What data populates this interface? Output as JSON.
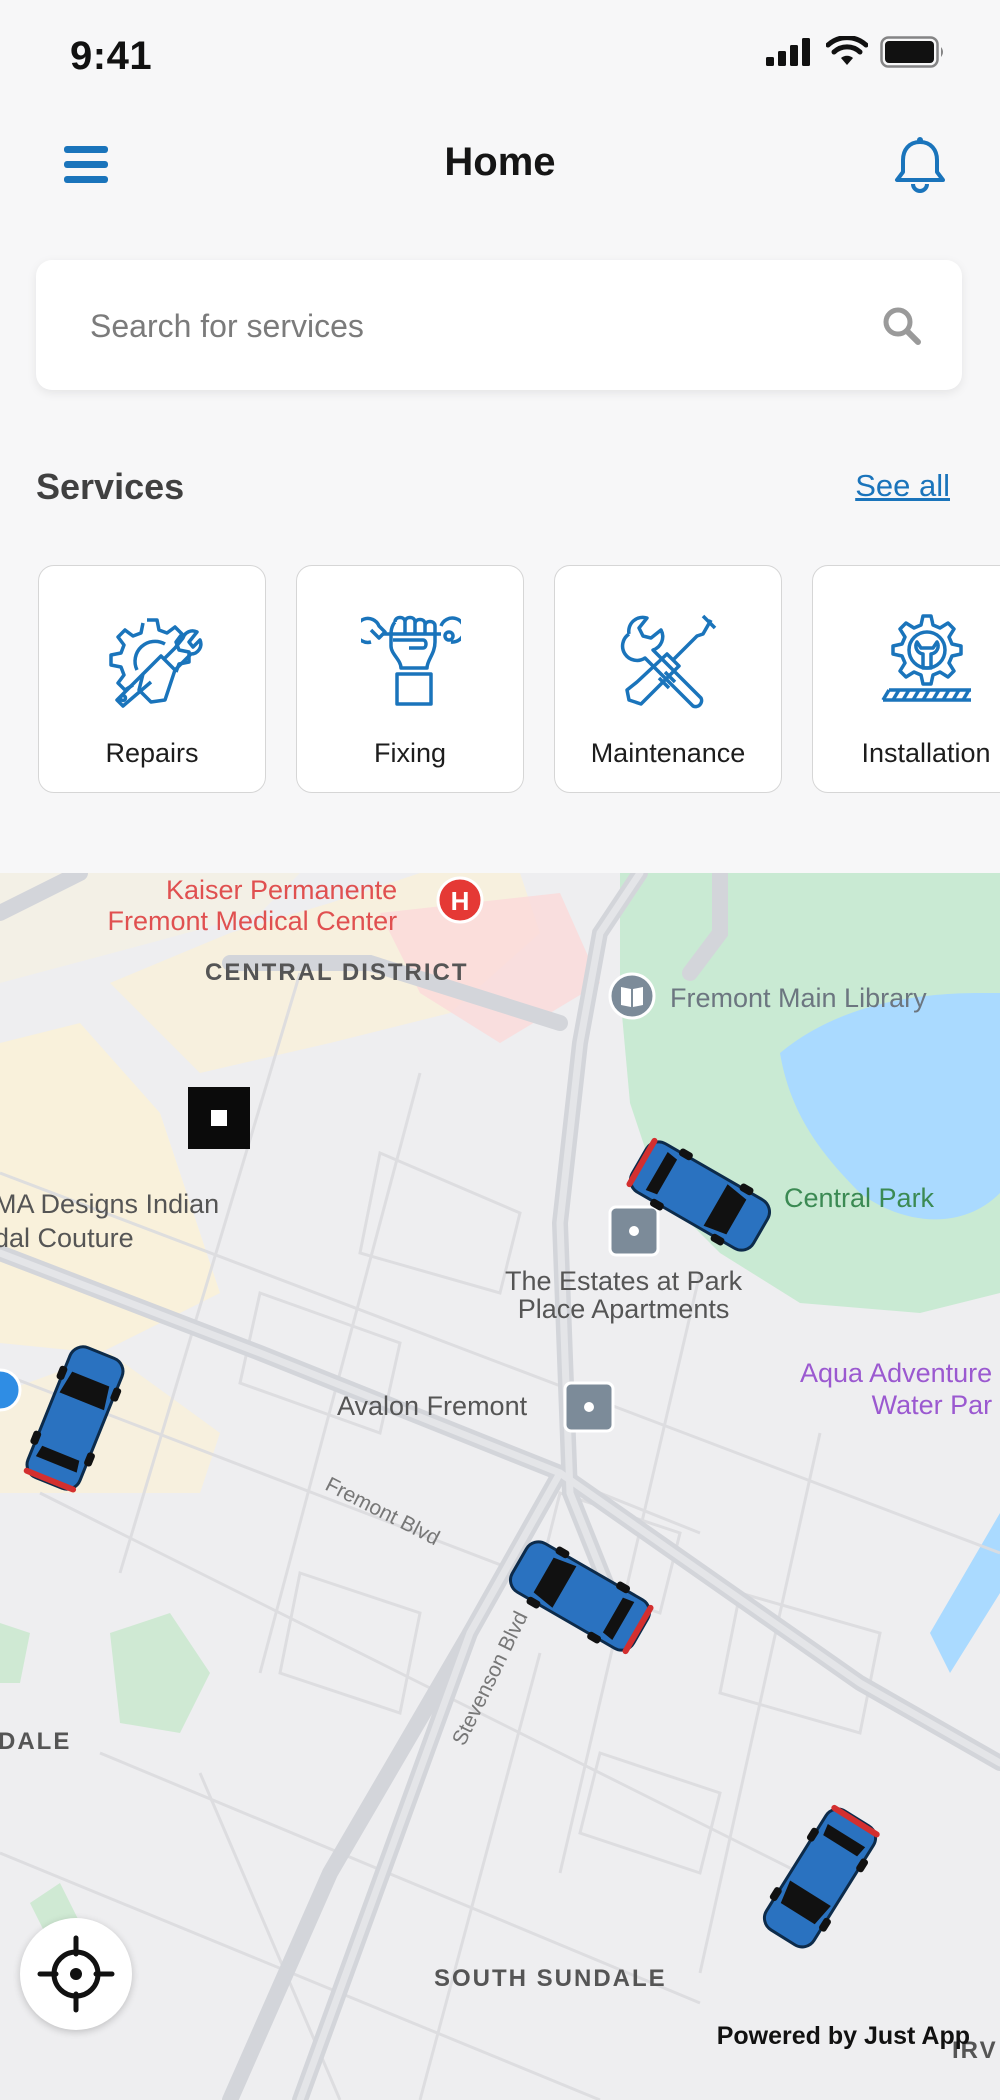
{
  "status_bar": {
    "time": "9:41"
  },
  "header": {
    "title": "Home"
  },
  "search": {
    "placeholder": "Search for services"
  },
  "services": {
    "title": "Services",
    "see_all": "See all",
    "items": [
      {
        "label": "Repairs",
        "icon": "repair-gear-wrench-icon"
      },
      {
        "label": "Fixing",
        "icon": "fist-wrench-icon"
      },
      {
        "label": "Maintenance",
        "icon": "wrench-screwdriver-icon"
      },
      {
        "label": "Installation",
        "icon": "gear-installation-icon"
      }
    ]
  },
  "map": {
    "labels": {
      "kaiser_line1": "Kaiser Permanente",
      "kaiser_line2": "Fremont Medical Center",
      "central_district": "CENTRAL DISTRICT",
      "library": "Fremont Main Library",
      "designs_line1": "MA Designs Indian",
      "designs_line2": "dal Couture",
      "central_park": "Central Park",
      "estates_line1": "The Estates at Park",
      "estates_line2": "Place Apartments",
      "aqua_line1": "Aqua Adventure",
      "aqua_line2": "Water Par",
      "avalon": "Avalon Fremont",
      "fremont_blvd": "Fremont Blvd",
      "stevenson_blvd": "Stevenson Blvd",
      "dale": "DALE",
      "south_sundale": "SOUTH SUNDALE",
      "irv": "IRV"
    },
    "powered_by": "Powered by Just App"
  },
  "colors": {
    "accent": "#1a74bb",
    "car_body": "#2a72c0",
    "hospital": "#e53935",
    "park": "#c9ead3",
    "water": "#aadaff"
  }
}
